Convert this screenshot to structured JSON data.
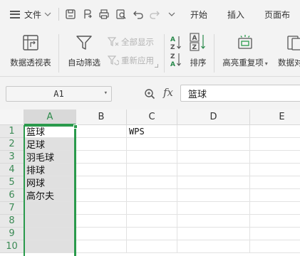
{
  "menubar": {
    "file_label": "文件",
    "tabs": [
      "开始",
      "插入",
      "页面布"
    ]
  },
  "ribbon": {
    "pivot_label": "数据透视表",
    "autofilter_label": "自动筛选",
    "show_all_label": "全部显示",
    "reapply_label": "重新应用",
    "sort_label": "排序",
    "highlight_dup_label": "高亮重复项",
    "data_compare_label": "数据对"
  },
  "formula_bar": {
    "name_box": "A1",
    "fx_label": "fx",
    "content": "篮球"
  },
  "grid": {
    "columns": [
      "A",
      "B",
      "C",
      "D",
      "E"
    ],
    "rows": [
      "1",
      "2",
      "3",
      "4",
      "5",
      "6",
      "7",
      "8",
      "9",
      "10"
    ],
    "cells": {
      "A1": "篮球",
      "A2": "足球",
      "A3": "羽毛球",
      "A4": "排球",
      "A5": "网球",
      "A6": "高尔夫",
      "C1": "WPS"
    }
  },
  "colors": {
    "selection": "#2a9a4c",
    "active_header_text": "#2c8a4a"
  }
}
